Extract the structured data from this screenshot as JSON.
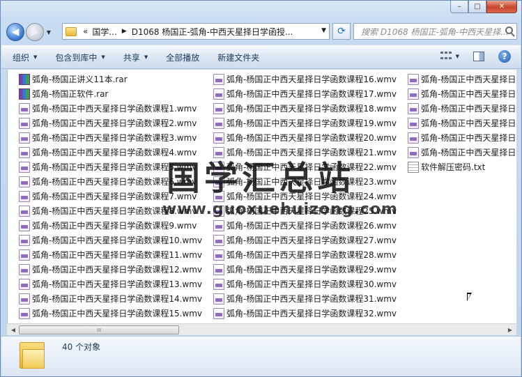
{
  "window": {
    "caption": {
      "minimize": "–",
      "maximize": "□",
      "close": "✕"
    }
  },
  "nav": {
    "back_glyph": "◀",
    "forward_glyph": "▶",
    "crumb_overflow": "«",
    "crumbs": [
      "国学...",
      "D1068 杨国正-弧角-中西天星择日学函授..."
    ],
    "search_placeholder": "搜索 D1068 杨国正-弧角-中西天星择..."
  },
  "toolbar": {
    "organize": "组织",
    "include_in_library": "包含到库中",
    "share": "共享",
    "play_all": "全部播放",
    "new_folder": "新建文件夹",
    "help": "?"
  },
  "files": {
    "col1": [
      {
        "name": "弧角-杨国正讲义11本.rar",
        "icon": "rar-icon"
      },
      {
        "name": "弧角-杨国正软件.rar",
        "icon": "rar-icon"
      },
      {
        "name": "弧角-杨国正中西天星择日学函数课程1.wmv",
        "icon": "wmv-icon"
      },
      {
        "name": "弧角-杨国正中西天星择日学函数课程2.wmv",
        "icon": "wmv-icon"
      },
      {
        "name": "弧角-杨国正中西天星择日学函数课程3.wmv",
        "icon": "wmv-icon"
      },
      {
        "name": "弧角-杨国正中西天星择日学函数课程4.wmv",
        "icon": "wmv-icon"
      },
      {
        "name": "弧角-杨国正中西天星择日学函数课程5.wmv",
        "icon": "wmv-icon"
      },
      {
        "name": "弧角-杨国正中西天星择日学函数课程6.wmv",
        "icon": "wmv-icon"
      },
      {
        "name": "弧角-杨国正中西天星择日学函数课程7.wmv",
        "icon": "wmv-icon"
      },
      {
        "name": "弧角-杨国正中西天星择日学函数课程8.wmv",
        "icon": "wmv-icon"
      },
      {
        "name": "弧角-杨国正中西天星择日学函数课程9.wmv",
        "icon": "wmv-icon"
      },
      {
        "name": "弧角-杨国正中西天星择日学函数课程10.wmv",
        "icon": "wmv-icon"
      },
      {
        "name": "弧角-杨国正中西天星择日学函数课程11.wmv",
        "icon": "wmv-icon"
      },
      {
        "name": "弧角-杨国正中西天星择日学函数课程12.wmv",
        "icon": "wmv-icon"
      },
      {
        "name": "弧角-杨国正中西天星择日学函数课程13.wmv",
        "icon": "wmv-icon"
      },
      {
        "name": "弧角-杨国正中西天星择日学函数课程14.wmv",
        "icon": "wmv-icon"
      },
      {
        "name": "弧角-杨国正中西天星择日学函数课程15.wmv",
        "icon": "wmv-icon"
      }
    ],
    "col2": [
      {
        "name": "弧角-杨国正中西天星择日学函数课程16.wmv",
        "icon": "wmv-icon"
      },
      {
        "name": "弧角-杨国正中西天星择日学函数课程17.wmv",
        "icon": "wmv-icon"
      },
      {
        "name": "弧角-杨国正中西天星择日学函数课程18.wmv",
        "icon": "wmv-icon"
      },
      {
        "name": "弧角-杨国正中西天星择日学函数课程19.wmv",
        "icon": "wmv-icon"
      },
      {
        "name": "弧角-杨国正中西天星择日学函数课程20.wmv",
        "icon": "wmv-icon"
      },
      {
        "name": "弧角-杨国正中西天星择日学函数课程21.wmv",
        "icon": "wmv-icon"
      },
      {
        "name": "弧角-杨国正中西天星择日学函数课程22.wmv",
        "icon": "wmv-icon"
      },
      {
        "name": "弧角-杨国正中西天星择日学函数课程23.wmv",
        "icon": "wmv-icon"
      },
      {
        "name": "弧角-杨国正中西天星择日学函数课程24.wmv",
        "icon": "wmv-icon"
      },
      {
        "name": "弧角-杨国正中西天星择日学函数课程25.wmv",
        "icon": "wmv-icon"
      },
      {
        "name": "弧角-杨国正中西天星择日学函数课程26.wmv",
        "icon": "wmv-icon"
      },
      {
        "name": "弧角-杨国正中西天星择日学函数课程27.wmv",
        "icon": "wmv-icon"
      },
      {
        "name": "弧角-杨国正中西天星择日学函数课程28.wmv",
        "icon": "wmv-icon"
      },
      {
        "name": "弧角-杨国正中西天星择日学函数课程29.wmv",
        "icon": "wmv-icon"
      },
      {
        "name": "弧角-杨国正中西天星择日学函数课程30.wmv",
        "icon": "wmv-icon"
      },
      {
        "name": "弧角-杨国正中西天星择日学函数课程31.wmv",
        "icon": "wmv-icon"
      },
      {
        "name": "弧角-杨国正中西天星择日学函数课程32.wmv",
        "icon": "wmv-icon"
      }
    ],
    "col3": [
      {
        "name": "弧角-杨国正中西天星择日学",
        "icon": "wmv-icon"
      },
      {
        "name": "弧角-杨国正中西天星择日学",
        "icon": "wmv-icon"
      },
      {
        "name": "弧角-杨国正中西天星择日学",
        "icon": "wmv-icon"
      },
      {
        "name": "弧角-杨国正中西天星择日学",
        "icon": "wmv-icon"
      },
      {
        "name": "弧角-杨国正中西天星择日学",
        "icon": "wmv-icon"
      },
      {
        "name": "弧角-杨国正中西天星择日学",
        "icon": "wmv-icon"
      },
      {
        "name": "软件解压密码.txt",
        "icon": "txt-icon"
      }
    ]
  },
  "watermark": {
    "line1": "国学汇总站",
    "line2": "www.guoxuehuizong.com"
  },
  "scrollbar": {
    "left_arrow": "◀",
    "right_arrow": "▶",
    "grip": "III"
  },
  "status": {
    "count": "40 个对象"
  }
}
